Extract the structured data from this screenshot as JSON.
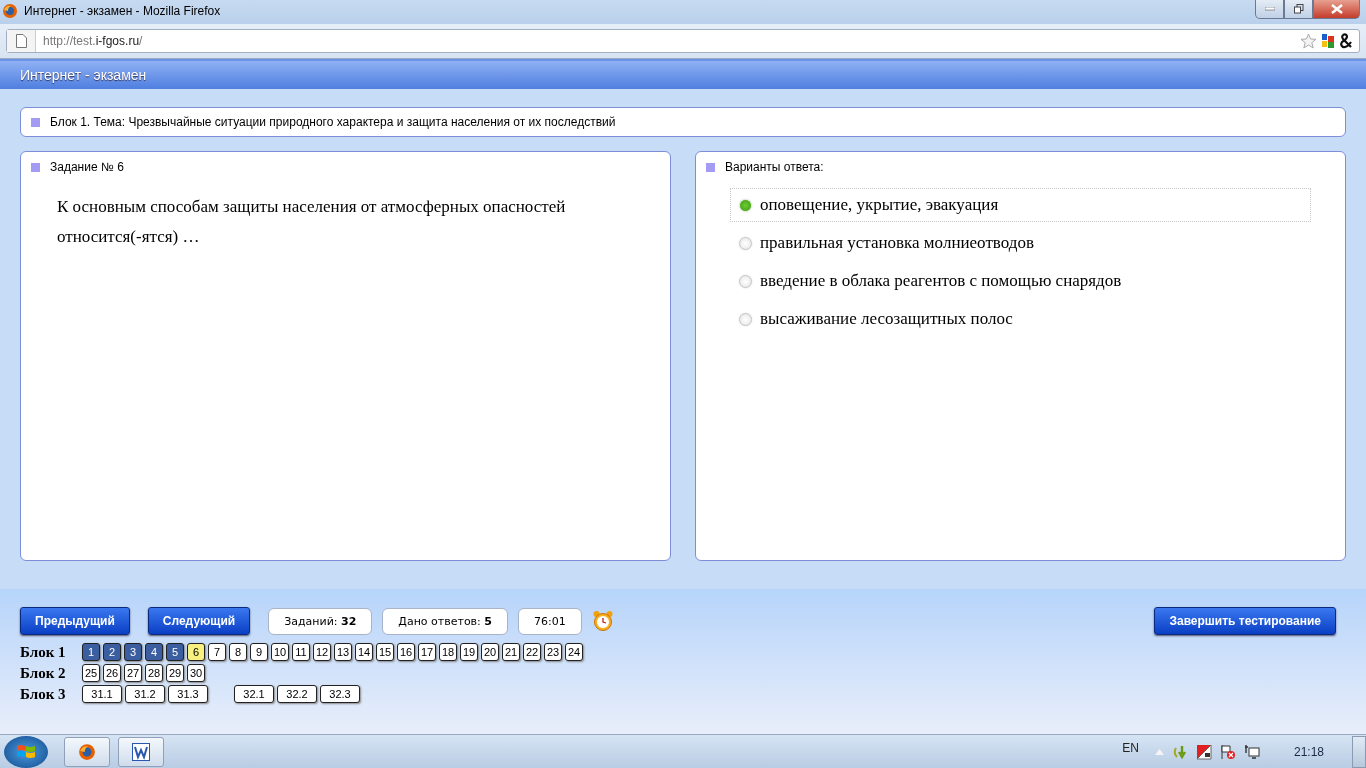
{
  "window": {
    "title": "Интернет - экзамен - Mozilla Firefox"
  },
  "address_bar": {
    "url_prefix": "http://test.",
    "url_domain": "i-fgos.ru",
    "url_suffix": "/"
  },
  "app_header": {
    "title": "Интернет - экзамен"
  },
  "topic": {
    "text": "Блок 1. Тема: Чрезвычайные ситуации природного характера и защита населения от их последствий"
  },
  "question": {
    "heading": "Задание № 6",
    "text": "К основным способам защиты населения от атмосферных опасностей относится(-ятся) …"
  },
  "answers": {
    "heading": "Варианты ответа:",
    "options": [
      {
        "label": "оповещение, укрытие, эвакуация",
        "selected": true
      },
      {
        "label": "правильная установка молниеотводов",
        "selected": false
      },
      {
        "label": "введение в облака реагентов с помощью снарядов",
        "selected": false
      },
      {
        "label": "высаживание лесозащитных полос",
        "selected": false
      }
    ]
  },
  "controls": {
    "prev": "Предыдущий",
    "next": "Следующий",
    "tasks": "Заданий: **32**",
    "answered": "Дано ответов: **5**",
    "timer": "76:01",
    "finish": "Завершить тестирование"
  },
  "blocks": [
    {
      "label": "Блок 1",
      "groups": [
        [
          {
            "n": "1",
            "answered": true,
            "selected": false
          },
          {
            "n": "2",
            "answered": true,
            "selected": false
          },
          {
            "n": "3",
            "answered": true,
            "selected": false
          },
          {
            "n": "4",
            "answered": true,
            "selected": false
          },
          {
            "n": "5",
            "answered": true,
            "selected": false
          },
          {
            "n": "6",
            "answered": false,
            "selected": true
          },
          {
            "n": "7",
            "answered": false,
            "selected": false
          },
          {
            "n": "8",
            "answered": false,
            "selected": false
          },
          {
            "n": "9",
            "answered": false,
            "selected": false
          },
          {
            "n": "10",
            "answered": false,
            "selected": false
          },
          {
            "n": "11",
            "answered": false,
            "selected": false
          },
          {
            "n": "12",
            "answered": false,
            "selected": false
          },
          {
            "n": "13",
            "answered": false,
            "selected": false
          },
          {
            "n": "14",
            "answered": false,
            "selected": false
          },
          {
            "n": "15",
            "answered": false,
            "selected": false
          },
          {
            "n": "16",
            "answered": false,
            "selected": false
          },
          {
            "n": "17",
            "answered": false,
            "selected": false
          },
          {
            "n": "18",
            "answered": false,
            "selected": false
          },
          {
            "n": "19",
            "answered": false,
            "selected": false
          },
          {
            "n": "20",
            "answered": false,
            "selected": false
          },
          {
            "n": "21",
            "answered": false,
            "selected": false
          },
          {
            "n": "22",
            "answered": false,
            "selected": false
          },
          {
            "n": "23",
            "answered": false,
            "selected": false
          },
          {
            "n": "24",
            "answered": false,
            "selected": false
          }
        ]
      ]
    },
    {
      "label": "Блок 2",
      "groups": [
        [
          {
            "n": "25",
            "answered": false,
            "selected": false
          },
          {
            "n": "26",
            "answered": false,
            "selected": false
          },
          {
            "n": "27",
            "answered": false,
            "selected": false
          },
          {
            "n": "28",
            "answered": false,
            "selected": false
          },
          {
            "n": "29",
            "answered": false,
            "selected": false
          },
          {
            "n": "30",
            "answered": false,
            "selected": false
          }
        ]
      ]
    },
    {
      "label": "Блок 3",
      "groups": [
        [
          {
            "n": "31.1",
            "answered": false,
            "selected": false
          },
          {
            "n": "31.2",
            "answered": false,
            "selected": false
          },
          {
            "n": "31.3",
            "answered": false,
            "selected": false
          }
        ],
        [
          {
            "n": "32.1",
            "answered": false,
            "selected": false
          },
          {
            "n": "32.2",
            "answered": false,
            "selected": false
          },
          {
            "n": "32.3",
            "answered": false,
            "selected": false
          }
        ]
      ]
    }
  ],
  "taskbar": {
    "language": "EN",
    "clock": "21:18"
  }
}
